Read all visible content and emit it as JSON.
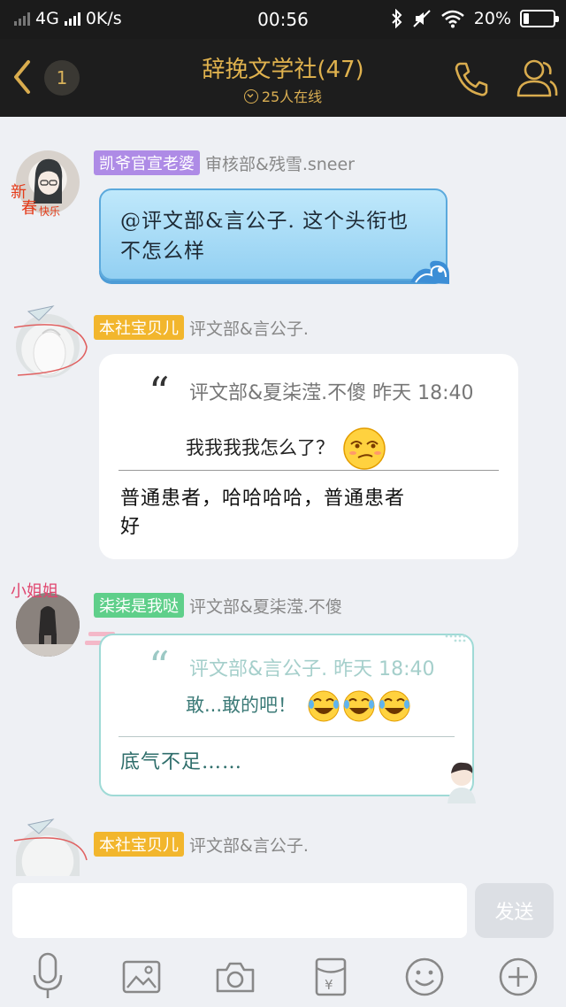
{
  "status_bar": {
    "network": "4G",
    "speed": "0K/s",
    "time": "00:56",
    "battery": "20%",
    "battery_level": 0.2
  },
  "header": {
    "unread_count": "1",
    "title": "辞挽文学社(47)",
    "online": "25人在线"
  },
  "messages": [
    {
      "tag": "凯爷官宣老婆",
      "sender": "审核部&残雪.sneer",
      "text": "@评文部&言公子. 这个头衔也不怎么样"
    },
    {
      "tag": "本社宝贝儿",
      "sender": "评文部&言公子.",
      "quote_source": "评文部&夏柒滢.不傻 昨天 18:40",
      "quote_text": "我我我我怎么了？",
      "reply": "普通患者，哈哈哈哈，普通患者好"
    },
    {
      "tag": "柒柒是我哒",
      "sender": "评文部&夏柒滢.不傻",
      "quote_source": "评文部&言公子. 昨天 18:40",
      "quote_text": "敢...敢的吧！",
      "reply": "底气不足……"
    },
    {
      "tag": "本社宝贝儿",
      "sender": "评文部&言公子."
    }
  ],
  "input": {
    "placeholder": "",
    "send_label": "发送"
  },
  "toolbar": [
    "microphone-icon",
    "image-icon",
    "camera-icon",
    "red-packet-icon",
    "emoji-icon",
    "plus-icon"
  ],
  "colors": {
    "header_bg": "#1d1d1d",
    "accent_gold": "#e0b24e",
    "tag_purple": "#ae8be6",
    "tag_gold": "#f2b62d",
    "tag_green": "#5fcf8a"
  }
}
